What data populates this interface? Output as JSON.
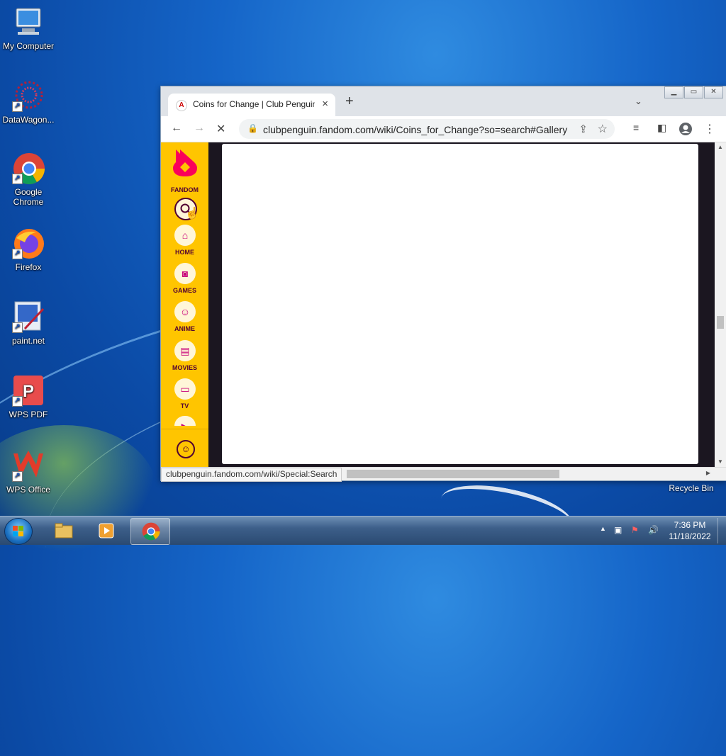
{
  "desktop": {
    "icons": [
      {
        "label": "My Computer"
      },
      {
        "label": "DataWagon..."
      },
      {
        "label": "Google Chrome"
      },
      {
        "label": "Firefox"
      },
      {
        "label": "paint.net"
      },
      {
        "label": "WPS PDF"
      },
      {
        "label": "WPS Office"
      }
    ],
    "recycle_bin": "Recycle Bin"
  },
  "browser": {
    "tab_title": "Coins for Change | Club Penguin",
    "tab_close": "×",
    "new_tab": "+",
    "tab_menu": "⌄",
    "window_buttons": {
      "minimize": "▁",
      "maximize": "▭",
      "close": "✕"
    },
    "url": "clubpenguin.fandom.com/wiki/Coins_for_Change?so=search#Gallery",
    "status_text": "clubpenguin.fandom.com/wiki/Special:Search"
  },
  "fandom_sidebar": {
    "brand": "FANDOM",
    "items": [
      {
        "label": "HOME",
        "icon": "home-icon"
      },
      {
        "label": "GAMES",
        "icon": "gamepad-icon"
      },
      {
        "label": "ANIME",
        "icon": "anime-icon"
      },
      {
        "label": "MOVIES",
        "icon": "clapper-icon"
      },
      {
        "label": "TV",
        "icon": "tv-icon"
      }
    ],
    "colors": {
      "background": "#ffc500",
      "accent": "#c8007a",
      "text": "#520032"
    }
  },
  "taskbar": {
    "time": "7:36 PM",
    "date": "11/18/2022"
  }
}
